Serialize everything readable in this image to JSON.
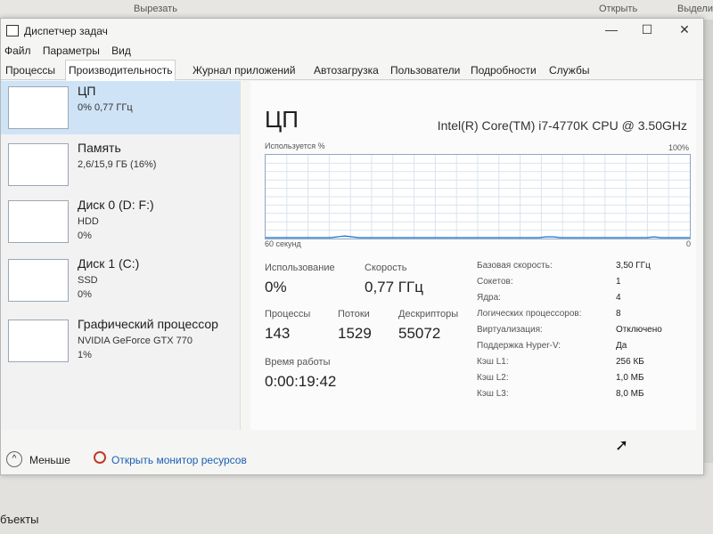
{
  "background": {
    "top_items": [
      "Вырезать",
      "Открыть",
      "Выделит"
    ],
    "bottom_label": "бъекты"
  },
  "window": {
    "title": "Диспетчер задач",
    "controls": {
      "minimize": "—",
      "maximize": "☐",
      "close": "✕"
    }
  },
  "menu": [
    "Файл",
    "Параметры",
    "Вид"
  ],
  "tabs": [
    "Процессы",
    "Производительность",
    "Журнал приложений",
    "Автозагрузка",
    "Пользователи",
    "Подробности",
    "Службы"
  ],
  "active_tab": "Производительность",
  "resources": [
    {
      "name": "ЦП",
      "lines": [
        "0% 0,77 ГГц"
      ]
    },
    {
      "name": "Память",
      "lines": [
        "2,6/15,9 ГБ (16%)"
      ]
    },
    {
      "name": "Диск 0 (D: F:)",
      "lines": [
        "HDD",
        "0%"
      ]
    },
    {
      "name": "Диск 1 (C:)",
      "lines": [
        "SSD",
        "0%"
      ]
    },
    {
      "name": "Графический процессор",
      "lines": [
        "NVIDIA GeForce GTX 770",
        "1%"
      ]
    }
  ],
  "main": {
    "title": "ЦП",
    "model": "Intel(R) Core(TM) i7-4770K CPU @ 3.50GHz",
    "graph": {
      "y_label": "Используется %",
      "y_max": "100%",
      "x_label": "60 секунд",
      "x_min": "0",
      "usage_pct": [
        0,
        0,
        0,
        0,
        0,
        0,
        0,
        0,
        0,
        0,
        1,
        2,
        1,
        0,
        0,
        0,
        0,
        0,
        0,
        0,
        0,
        0,
        0,
        0,
        0,
        0,
        0,
        0,
        0,
        0,
        0,
        0,
        0,
        0,
        0,
        0,
        0,
        0,
        0,
        1,
        1,
        0,
        0,
        0,
        0,
        0,
        0,
        0,
        0,
        0,
        0,
        0,
        0,
        0,
        1,
        0,
        0,
        0,
        0,
        0
      ]
    },
    "stats": {
      "usage_label": "Использование",
      "usage_value": "0%",
      "speed_label": "Скорость",
      "speed_value": "0,77 ГГц",
      "processes_label": "Процессы",
      "processes_value": "143",
      "threads_label": "Потоки",
      "threads_value": "1529",
      "handles_label": "Дескрипторы",
      "handles_value": "55072",
      "uptime_label": "Время работы",
      "uptime_value": "0:00:19:42"
    },
    "specs": [
      {
        "label": "Базовая скорость:",
        "value": "3,50 ГГц"
      },
      {
        "label": "Сокетов:",
        "value": "1"
      },
      {
        "label": "Ядра:",
        "value": "4"
      },
      {
        "label": "Логических процессоров:",
        "value": "8"
      },
      {
        "label": "Виртуализация:",
        "value": "Отключено"
      },
      {
        "label": "Поддержка Hyper-V:",
        "value": "Да"
      },
      {
        "label": "Кэш L1:",
        "value": "256 КБ"
      },
      {
        "label": "Кэш L2:",
        "value": "1,0 МБ"
      },
      {
        "label": "Кэш L3:",
        "value": "8,0 МБ"
      }
    ]
  },
  "footer": {
    "less_label": "Меньше",
    "monitor_label": "Открыть монитор ресурсов"
  }
}
